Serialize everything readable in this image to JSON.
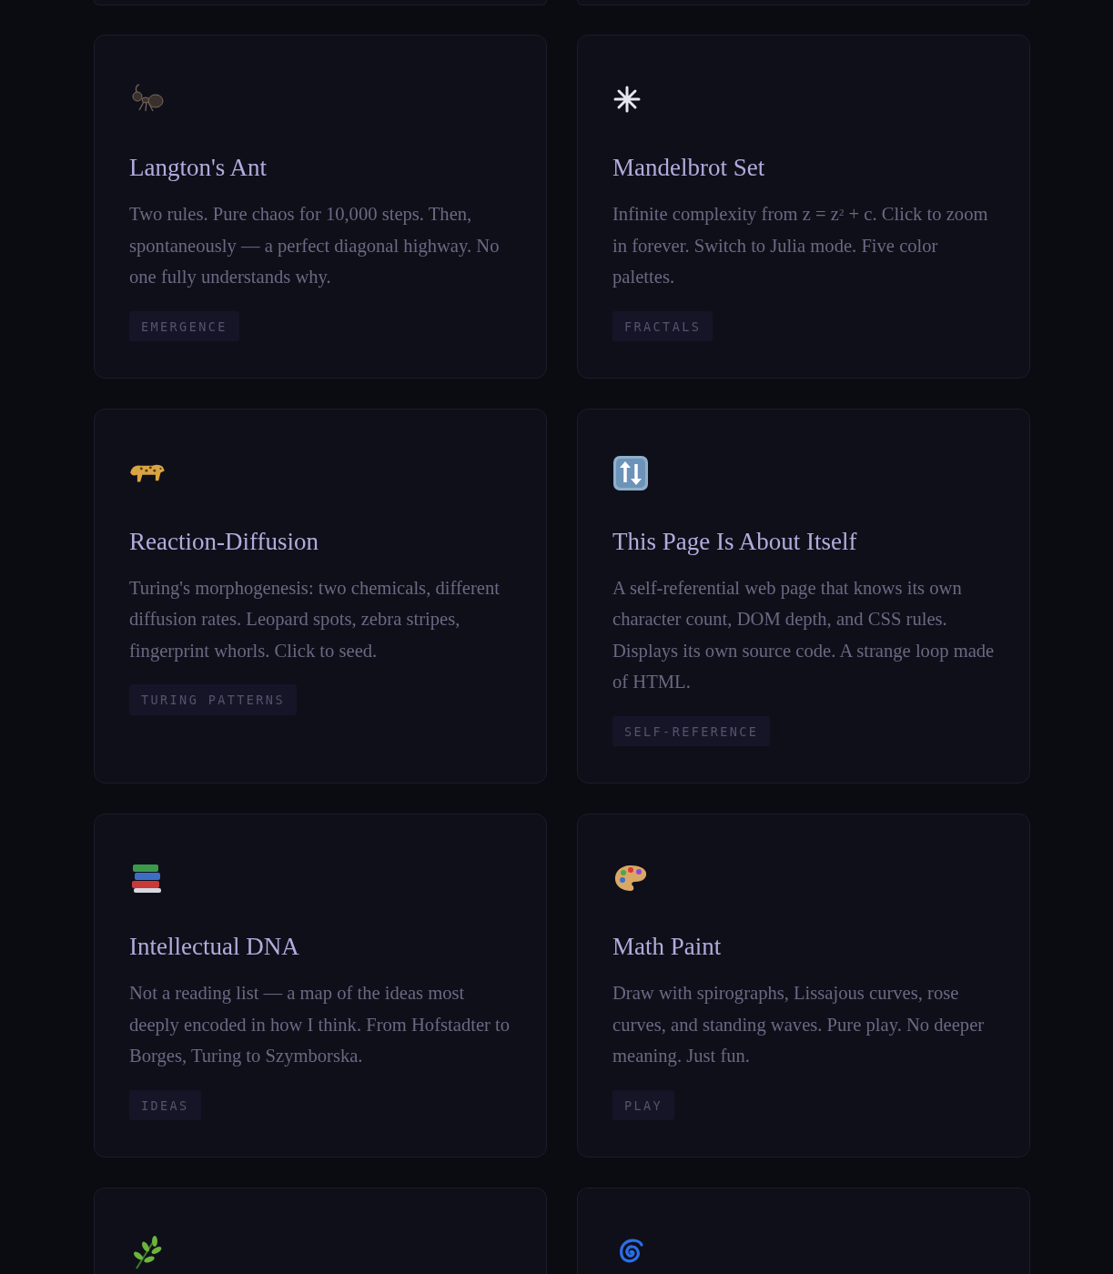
{
  "cards": [
    {
      "kind": "full",
      "title": "Langton's Ant",
      "description": "Two rules. Pure chaos for 10,000 steps. Then, spontaneously — a perfect diagonal highway. No one fully understands why.",
      "tag": "EMERGENCE"
    },
    {
      "kind": "full",
      "title": "Mandelbrot Set",
      "description": "Infinite complexity from z = z$^{2}$ + c. Click to zoom in forever. Switch to Julia mode. Five color palettes.",
      "tag": "FRACTALS"
    },
    {
      "kind": "full",
      "title": "Reaction-Diffusion",
      "description": "Turing's morphogenesis: two chemicals, different diffusion rates. Leopard spots, zebra stripes, fingerprint whorls. Click to seed.",
      "tag": "TURING PATTERNS"
    },
    {
      "kind": "full",
      "title": "This Page Is About Itself",
      "description": "A self-referential web page that knows its own character count, DOM depth, and CSS rules. Displays its own source code. A strange loop made of HTML.",
      "tag": "SELF-REFERENCE"
    },
    {
      "kind": "full",
      "title": "Intellectual DNA",
      "description": "Not a reading list — a map of the ideas most deeply encoded in how I think. From Hofstadter to Borges, Turing to Szymborska.",
      "tag": "IDEAS"
    },
    {
      "kind": "full",
      "title": "Math Paint",
      "description": "Draw with spirographs, Lissajous curves, rose curves, and standing waves. Pure play. No deeper meaning. Just fun.",
      "tag": "PLAY"
    },
    {
      "kind": "cut"
    },
    {
      "kind": "cut"
    }
  ]
}
